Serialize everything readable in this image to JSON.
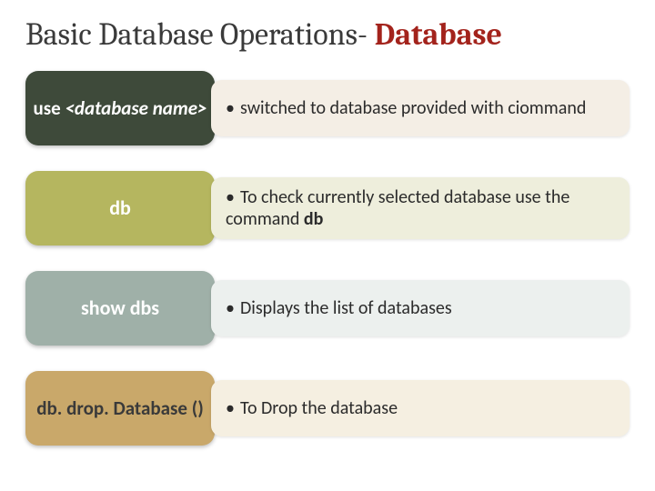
{
  "title": {
    "prefix": "Basic Database Operations- ",
    "accent": "Database"
  },
  "rows": [
    {
      "cmd_main": "use",
      "cmd_arg": "<database name>",
      "desc_prefix": "switched to database provided with ciommand",
      "desc_bold": ""
    },
    {
      "cmd_main": "db",
      "cmd_arg": "",
      "desc_prefix": "To check currently selected database use the command ",
      "desc_bold": "db"
    },
    {
      "cmd_main": "show dbs",
      "cmd_arg": "",
      "desc_prefix": "Displays the list of databases",
      "desc_bold": ""
    },
    {
      "cmd_main": "db. drop. Database ()",
      "cmd_arg": "",
      "desc_prefix": "To Drop the database",
      "desc_bold": ""
    }
  ]
}
